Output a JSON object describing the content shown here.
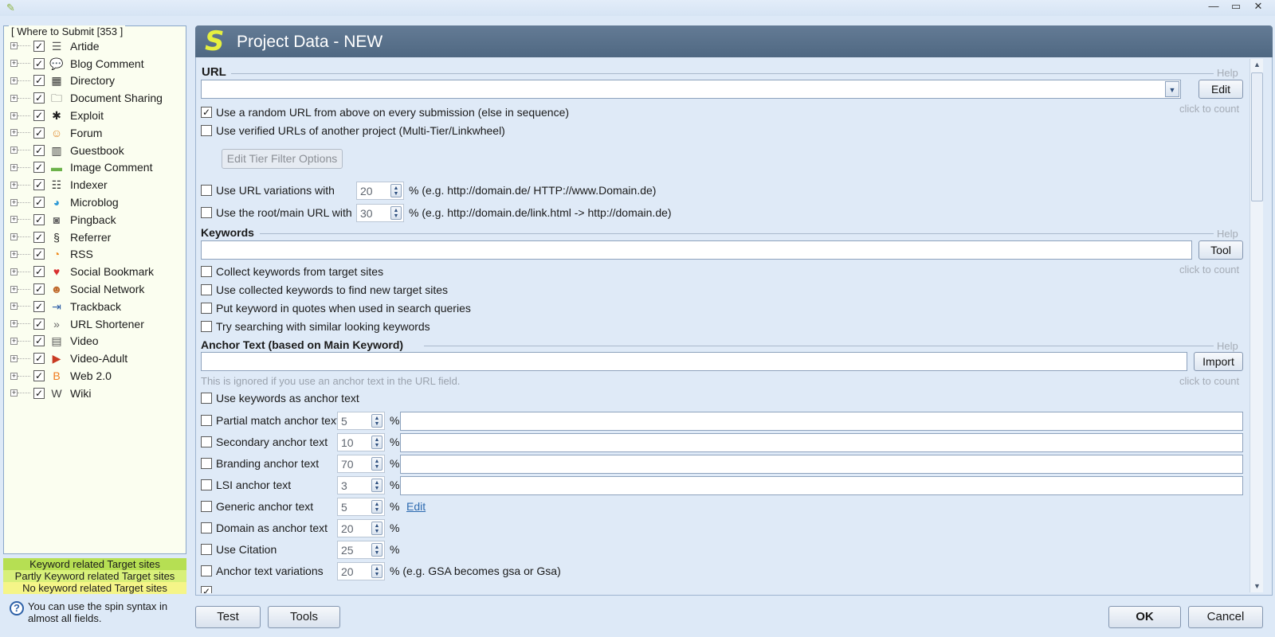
{
  "window": {
    "minimize_glyph": "—",
    "maximize_glyph": "▭",
    "close_glyph": "✕"
  },
  "left_panel": {
    "title": "[ Where to Submit  [353 ]",
    "items": [
      {
        "label": "Artide",
        "icon": "article-icon",
        "glyph": "☰",
        "color": "#555"
      },
      {
        "label": "Blog Comment",
        "icon": "blog-comment-icon",
        "glyph": "💬",
        "color": "#888"
      },
      {
        "label": "Directory",
        "icon": "directory-icon",
        "glyph": "▦",
        "color": "#333"
      },
      {
        "label": "Document Sharing",
        "icon": "document-sharing-icon",
        "glyph": "🗀",
        "color": "#444"
      },
      {
        "label": "Exploit",
        "icon": "exploit-icon",
        "glyph": "✱",
        "color": "#222"
      },
      {
        "label": "Forum",
        "icon": "forum-icon",
        "glyph": "☺",
        "color": "#e08a2c"
      },
      {
        "label": "Guestbook",
        "icon": "guestbook-icon",
        "glyph": "▥",
        "color": "#333"
      },
      {
        "label": "Image Comment",
        "icon": "image-comment-icon",
        "glyph": "▬",
        "color": "#6cb24a"
      },
      {
        "label": "Indexer",
        "icon": "indexer-icon",
        "glyph": "☷",
        "color": "#333"
      },
      {
        "label": "Microblog",
        "icon": "microblog-icon",
        "glyph": "◕",
        "color": "#2f9ad6"
      },
      {
        "label": "Pingback",
        "icon": "pingback-icon",
        "glyph": "◙",
        "color": "#666"
      },
      {
        "label": "Referrer",
        "icon": "referrer-icon",
        "glyph": "§",
        "color": "#222"
      },
      {
        "label": "RSS",
        "icon": "rss-icon",
        "glyph": "◔",
        "color": "#f08a1c"
      },
      {
        "label": "Social Bookmark",
        "icon": "social-bookmark-icon",
        "glyph": "♥",
        "color": "#d93030"
      },
      {
        "label": "Social Network",
        "icon": "social-network-icon",
        "glyph": "☻",
        "color": "#c06a2c"
      },
      {
        "label": "Trackback",
        "icon": "trackback-icon",
        "glyph": "⇥",
        "color": "#2f5fa8"
      },
      {
        "label": "URL Shortener",
        "icon": "url-shortener-icon",
        "glyph": "»",
        "color": "#666"
      },
      {
        "label": "Video",
        "icon": "video-icon",
        "glyph": "▤",
        "color": "#555"
      },
      {
        "label": "Video-Adult",
        "icon": "video-adult-icon",
        "glyph": "▶",
        "color": "#c83a22"
      },
      {
        "label": "Web 2.0",
        "icon": "web20-icon",
        "glyph": "B",
        "color": "#f07a1c"
      },
      {
        "label": "Wiki",
        "icon": "wiki-icon",
        "glyph": "W",
        "color": "#444"
      }
    ],
    "legend": {
      "keyword": "Keyword related Target sites",
      "partly": "Partly Keyword related Target sites",
      "no_keyword": "No keyword related Target sites"
    },
    "hint": "You can use the spin syntax in almost all fields."
  },
  "main": {
    "title": "Project Data - NEW",
    "logo": "S",
    "url_section": {
      "title": "URL",
      "help": "Help",
      "edit_button": "Edit",
      "click_to_count": "click to count",
      "options": [
        {
          "label": "Use a random URL from above on every submission (else in sequence)",
          "checked": true
        },
        {
          "label": "Use verified URLs of another project (Multi-Tier/Linkwheel)",
          "checked": false
        }
      ],
      "tier_filter_button": "Edit Tier Filter Options",
      "variations": {
        "label": "Use URL variations with",
        "value": "20",
        "note": "% (e.g. http://domain.de/ HTTP://www.Domain.de)"
      },
      "root": {
        "label": "Use the root/main URL with",
        "value": "30",
        "note": "% (e.g. http://domain.de/link.html -> http://domain.de)"
      }
    },
    "keywords_section": {
      "title": "Keywords",
      "help": "Help",
      "tool_button": "Tool",
      "click_to_count": "click to count",
      "options": [
        {
          "label": "Collect keywords from target sites",
          "checked": false
        },
        {
          "label": "Use collected keywords to find new target sites",
          "checked": false
        },
        {
          "label": "Put keyword in quotes when used in search queries",
          "checked": false
        },
        {
          "label": "Try searching with similar looking keywords",
          "checked": false
        }
      ]
    },
    "anchor_section": {
      "title": "Anchor Text (based on Main Keyword)",
      "help": "Help",
      "import_button": "Import",
      "click_to_count": "click to count",
      "note": "This is ignored if you use an anchor text in the URL field.",
      "use_keywords": "Use keywords as anchor text",
      "rows": [
        {
          "label": "Partial match anchor text",
          "value": "5",
          "pct": "%"
        },
        {
          "label": "Secondary anchor text",
          "value": "10",
          "pct": "%"
        },
        {
          "label": "Branding anchor text",
          "value": "70",
          "pct": "%"
        },
        {
          "label": "LSI anchor text",
          "value": "3",
          "pct": "%"
        },
        {
          "label": "Generic anchor text",
          "value": "5",
          "pct": "%",
          "link": "Edit"
        },
        {
          "label": "Domain as anchor text",
          "value": "20",
          "pct": "%"
        },
        {
          "label": "Use Citation",
          "value": "25",
          "pct": "%"
        },
        {
          "label": "Anchor text variations",
          "value": "20",
          "pct": "% (e.g. GSA becomes gsa or Gsa)"
        }
      ]
    }
  },
  "footer": {
    "test": "Test",
    "tools": "Tools",
    "ok": "OK",
    "cancel": "Cancel"
  }
}
